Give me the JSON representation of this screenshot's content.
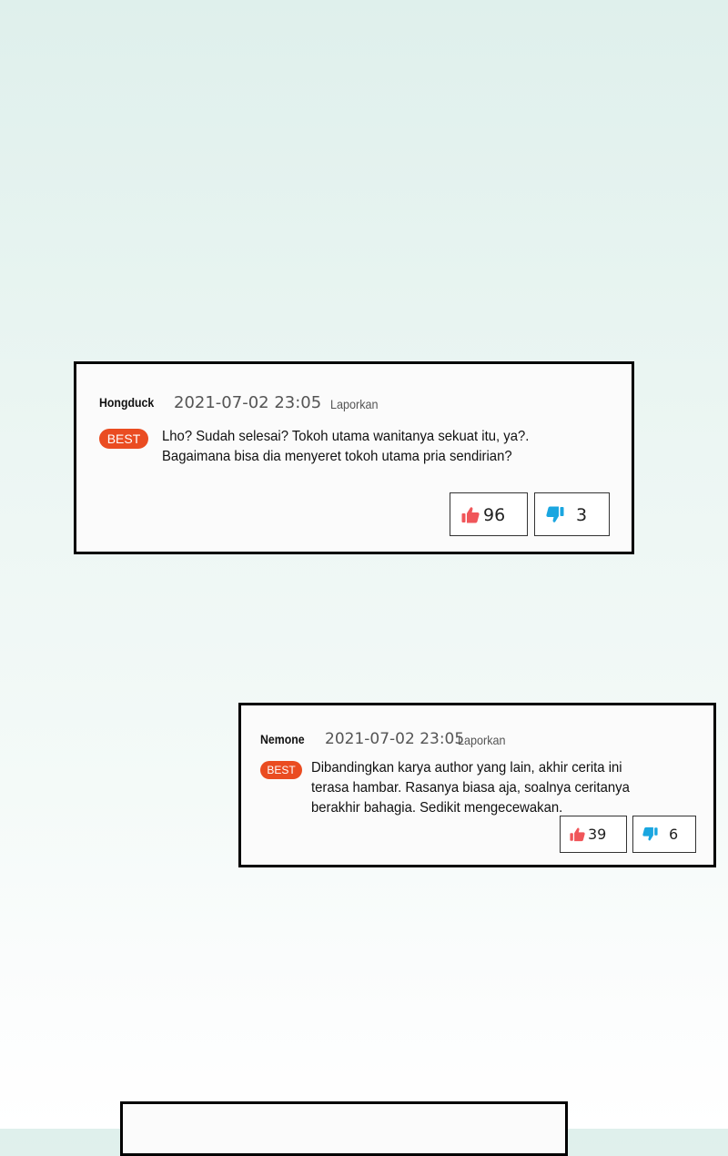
{
  "comments": [
    {
      "username": "Hongduck",
      "timestamp": "2021-07-02 23:05",
      "report_label": "Laporkan",
      "badge": "BEST",
      "text_lines": [
        "Lho? Sudah selesai? Tokoh utama wanitanya sekuat itu, ya?.",
        "Bagaimana bisa dia menyeret tokoh utama pria sendirian?"
      ],
      "likes": "96",
      "dislikes": "3"
    },
    {
      "username": "Nemone",
      "timestamp": "2021-07-02 23:05",
      "report_label": "Laporkan",
      "badge": "BEST",
      "text_lines": [
        "Dibandingkan karya author yang lain, akhir cerita ini",
        "terasa hambar. Rasanya biasa aja, soalnya ceritanya",
        "berakhir bahagia. Sedikit mengecewakan."
      ],
      "likes": "39",
      "dislikes": "6"
    }
  ],
  "icons": {
    "like": "thumbs-up-icon",
    "dislike": "thumbs-down-icon"
  },
  "colors": {
    "badge": "#ea4c21",
    "like_icon": "#f0565a",
    "dislike_icon": "#1aa6e0",
    "card_border": "#000000"
  }
}
